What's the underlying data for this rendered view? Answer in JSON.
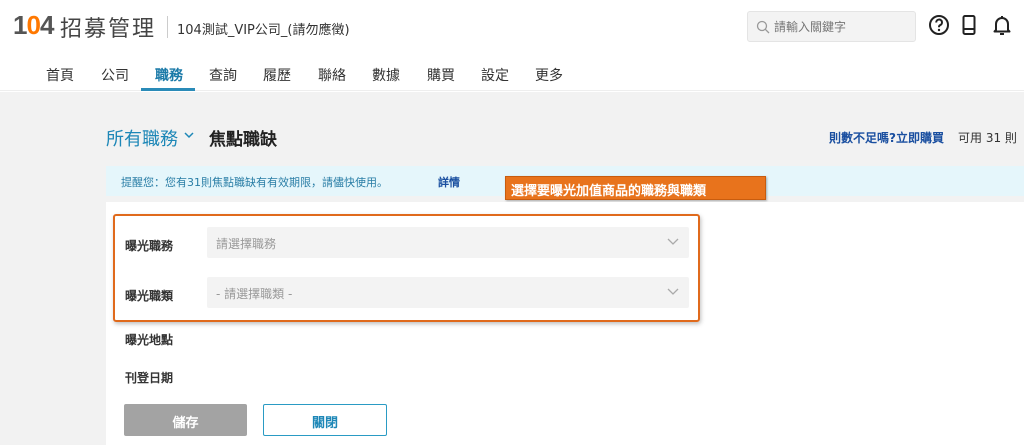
{
  "header": {
    "logo_number": "104",
    "logo_text": "招募管理",
    "company": "104測試_VIP公司_(請勿應徵)",
    "search_placeholder": "請輸入關鍵字"
  },
  "nav": {
    "items": [
      "首頁",
      "公司",
      "職務",
      "查詢",
      "履歷",
      "聯絡",
      "數據",
      "購買",
      "設定",
      "更多"
    ],
    "active_index": 2
  },
  "page": {
    "title_main": "所有職務",
    "title_sub": "焦點職缺",
    "buy_link": "則數不足嗎?立即購買",
    "available": "可用 31 則",
    "notice_text": "提醒您：您有31則焦點職缺有有效期限，請儘快使用。",
    "notice_link": "詳情",
    "callout": "選擇要曝光加值商品的職務與職類"
  },
  "form": {
    "job_label": "曝光職務",
    "job_placeholder": "請選擇職務",
    "category_label": "曝光職類",
    "category_placeholder": "- 請選擇職類 -",
    "location_label": "曝光地點",
    "date_label": "刊登日期",
    "save_label": "儲存",
    "close_label": "關閉"
  },
  "colors": {
    "accent": "#1d87b7",
    "callout": "#e8731c",
    "logo_orange": "#ff7800"
  }
}
